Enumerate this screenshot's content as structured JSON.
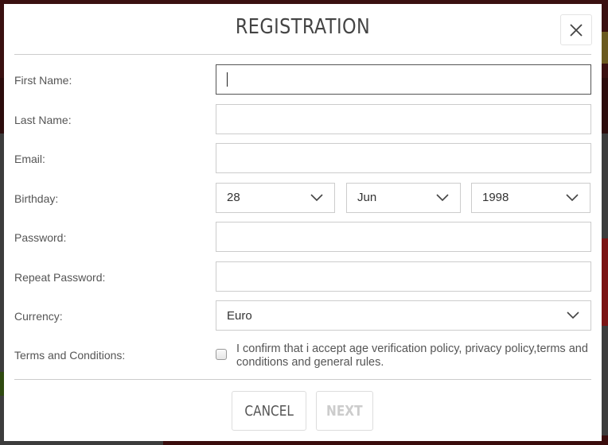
{
  "modal": {
    "title": "REGISTRATION",
    "close_icon": "close-icon"
  },
  "form": {
    "first_name": {
      "label": "First Name:",
      "value": "",
      "placeholder": ""
    },
    "last_name": {
      "label": "Last Name:",
      "value": "",
      "placeholder": ""
    },
    "email": {
      "label": "Email:",
      "value": "",
      "placeholder": ""
    },
    "birthday": {
      "label": "Birthday:",
      "day": "28",
      "month": "Jun",
      "year": "1998"
    },
    "password": {
      "label": "Password:",
      "value": "",
      "placeholder": ""
    },
    "repeat_password": {
      "label": "Repeat Password:",
      "value": "",
      "placeholder": ""
    },
    "currency": {
      "label": "Currency:",
      "value": "Euro"
    },
    "terms": {
      "label": "Terms and Conditions:",
      "text": "I confirm that i accept age verification policy, privacy policy,terms and conditions and general rules.",
      "checked": false
    }
  },
  "buttons": {
    "cancel": "CANCEL",
    "next": "NEXT"
  },
  "colors": {
    "text": "#555555",
    "border": "#cccccc",
    "disabled": "#cccccc"
  }
}
